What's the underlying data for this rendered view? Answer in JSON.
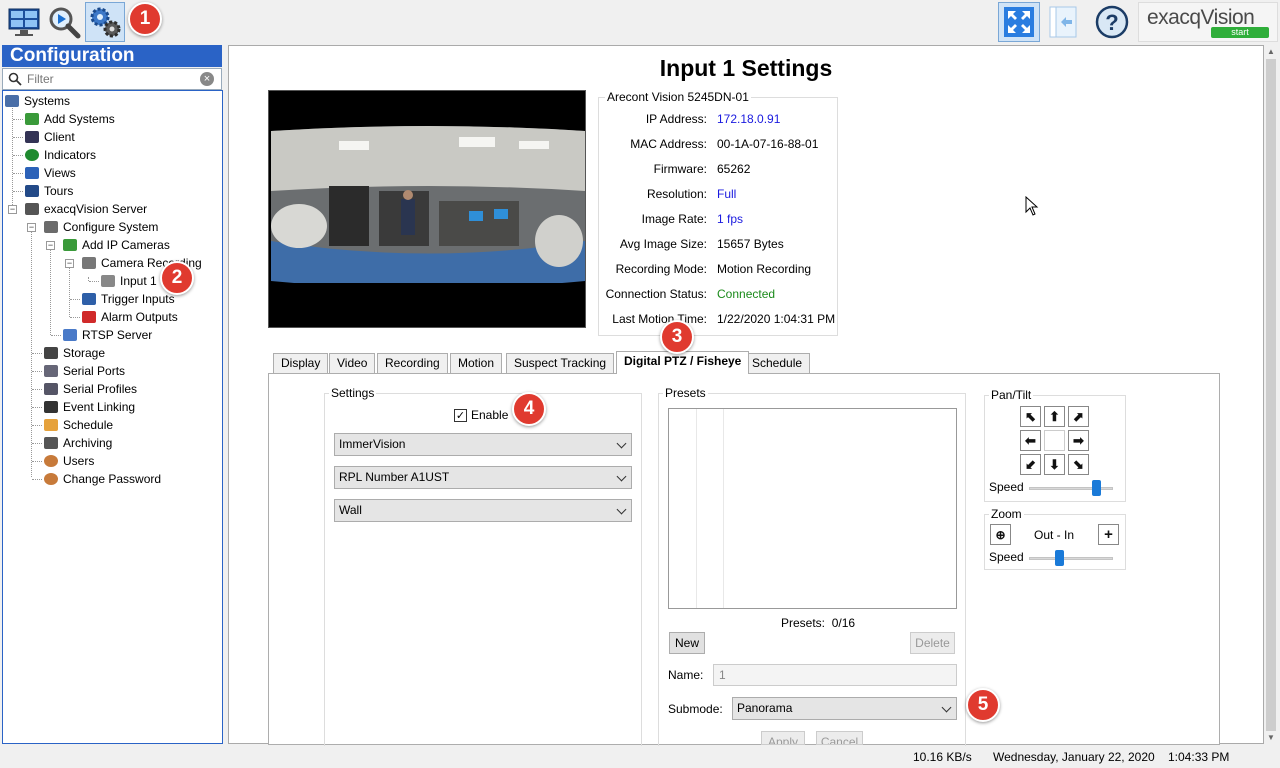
{
  "toolbar": {
    "icons": [
      "monitor-icon",
      "playback-search-icon",
      "configuration-gear-icon"
    ],
    "right_icons": [
      "fullscreen-icon",
      "dock-panel-icon",
      "help-icon"
    ],
    "brand": "exacqVision",
    "brand_tag": "start"
  },
  "callouts": [
    "1",
    "2",
    "3",
    "4",
    "5"
  ],
  "sidebar": {
    "title": "Configuration",
    "filter_placeholder": "Filter",
    "tree": [
      {
        "label": "Systems"
      },
      {
        "label": "Add Systems"
      },
      {
        "label": "Client"
      },
      {
        "label": "Indicators"
      },
      {
        "label": "Views"
      },
      {
        "label": "Tours"
      },
      {
        "label": "exacqVision Server"
      },
      {
        "label": "Configure System"
      },
      {
        "label": "Add IP Cameras"
      },
      {
        "label": "Camera Recording"
      },
      {
        "label": "Input 1"
      },
      {
        "label": "Trigger Inputs"
      },
      {
        "label": "Alarm Outputs"
      },
      {
        "label": "RTSP Server"
      },
      {
        "label": "Storage"
      },
      {
        "label": "Serial Ports"
      },
      {
        "label": "Serial Profiles"
      },
      {
        "label": "Event Linking"
      },
      {
        "label": "Schedule"
      },
      {
        "label": "Archiving"
      },
      {
        "label": "Users"
      },
      {
        "label": "Change Password"
      }
    ]
  },
  "main": {
    "title": "Input 1 Settings",
    "camera_model": "Arecont Vision 5245DN-01",
    "info": [
      {
        "key": "IP Address:",
        "value": "172.18.0.91",
        "color": "#1a1adf"
      },
      {
        "key": "MAC Address:",
        "value": "00-1A-07-16-88-01",
        "color": "#000000"
      },
      {
        "key": "Firmware:",
        "value": "65262",
        "color": "#000000"
      },
      {
        "key": "Resolution:",
        "value": "Full",
        "color": "#1a1adf"
      },
      {
        "key": "Image Rate:",
        "value": "1 fps",
        "color": "#1a1adf"
      },
      {
        "key": "Avg Image Size:",
        "value": "15657 Bytes",
        "color": "#000000"
      },
      {
        "key": "Recording Mode:",
        "value": "Motion Recording",
        "color": "#000000"
      },
      {
        "key": "Connection Status:",
        "value": "Connected",
        "color": "#1a8a1a"
      },
      {
        "key": "Last Motion Time:",
        "value": "1/22/2020 1:04:31 PM",
        "color": "#000000"
      }
    ],
    "tabs": [
      "Display",
      "Video",
      "Recording",
      "Motion",
      "Suspect Tracking",
      "Digital PTZ / Fisheye",
      "Schedule"
    ],
    "active_tab": "Digital PTZ / Fisheye"
  },
  "settings": {
    "legend": "Settings",
    "enable_label": "Enable",
    "enable_checked": true,
    "combo1": "ImmerVision",
    "combo2": "RPL Number A1UST",
    "combo3": "Wall"
  },
  "presets": {
    "legend": "Presets",
    "count_label": "Presets:",
    "count_value": "0/16",
    "new_label": "New",
    "delete_label": "Delete",
    "name_label": "Name:",
    "name_value": "1",
    "submode_label": "Submode:",
    "submode_value": "Panorama",
    "apply_label": "Apply",
    "cancel_label": "Cancel"
  },
  "pantilt": {
    "legend": "Pan/Tilt",
    "speed_label": "Speed",
    "speed_level": 0.84
  },
  "zoom": {
    "legend": "Zoom",
    "out_in_label": "Out - In",
    "speed_label": "Speed",
    "speed_level": 0.34
  },
  "status": {
    "rate": "10.16 KB/s",
    "date": "Wednesday, January 22, 2020",
    "time": "1:04:33 PM"
  }
}
